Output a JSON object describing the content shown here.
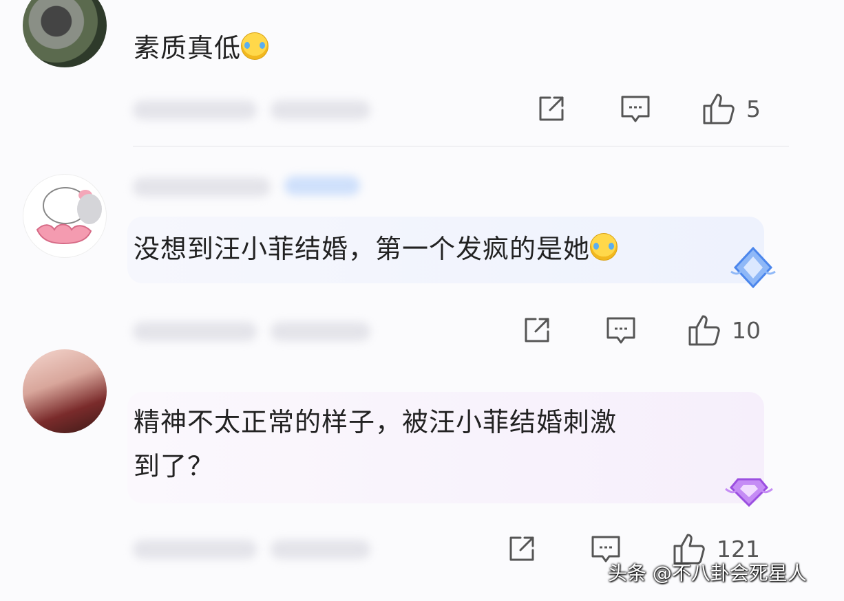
{
  "comments": [
    {
      "text": "素质真低",
      "emoji": "crying-laughing-emoji",
      "share_icon": "share-icon",
      "reply_icon": "reply-icon",
      "like_icon": "thumbs-up-icon",
      "likes": "5"
    },
    {
      "text": "没想到汪小菲结婚，第一个发疯的是她",
      "emoji": "crying-laughing-emoji",
      "badge_icon": "blue-diamond-badge-icon",
      "share_icon": "share-icon",
      "reply_icon": "reply-icon",
      "like_icon": "thumbs-up-icon",
      "likes": "10"
    },
    {
      "text_line1": "精神不太正常的样子，被汪小菲结婚刺激",
      "text_line2": "到了？",
      "badge_icon": "purple-diamond-badge-icon",
      "share_icon": "share-icon",
      "reply_icon": "reply-icon",
      "like_icon": "thumbs-up-icon",
      "likes": "121"
    }
  ],
  "watermark": "头条 @不八卦会死星人",
  "colors": {
    "text": "#222222",
    "icon": "#555555",
    "bubble_blue": "#eef2fd",
    "bubble_purple": "#f6effb"
  }
}
